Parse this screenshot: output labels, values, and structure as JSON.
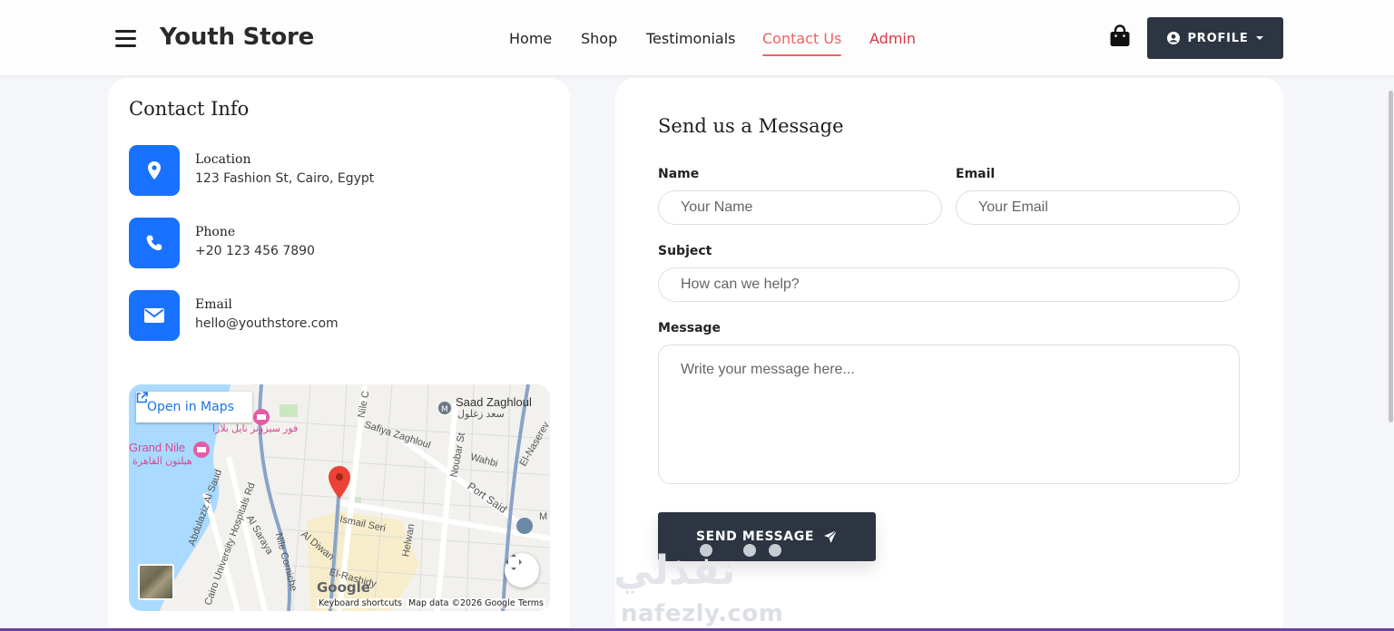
{
  "brand": {
    "name": "Youth Store"
  },
  "nav": {
    "items": [
      {
        "label": "Home"
      },
      {
        "label": "Shop"
      },
      {
        "label": "Testimonials"
      },
      {
        "label": "Contact Us",
        "active": true
      },
      {
        "label": "Admin"
      }
    ],
    "profile_label": "PROFILE",
    "cart_icon": "shopping-bag-icon",
    "profile_icon": "user-circle-icon"
  },
  "contact_info": {
    "title": "Contact Info",
    "items": [
      {
        "label": "Location",
        "value": "123 Fashion St, Cairo, Egypt",
        "icon": "map-pin-icon"
      },
      {
        "label": "Phone",
        "value": "+20 123 456 7890",
        "icon": "phone-icon"
      },
      {
        "label": "Email",
        "value": "hello@youthstore.com",
        "icon": "envelope-icon"
      }
    ]
  },
  "map": {
    "open_label": "Open in Maps",
    "labels": {
      "saad_zaghloul": "Saad Zaghloul",
      "saad_zaghloul_ar": "سعد زغلول",
      "grand_nile": "Grand Nile",
      "grand_nile_ar": "هيلتون القاهرة",
      "hotel_ar": "فور سيزونز نايل بلازا",
      "safiya_zaghloul": "Safiya Zaghloul",
      "noubar_st": "Noubar St",
      "wahbi": "Wahbi",
      "el_naserev": "El-Naserev",
      "port_said": "Port Said",
      "abdulaziz_al_saud": "Abdulaziz Al Saud",
      "cairo_university_hospitals": "Cairo University Hospitals Rd",
      "al_saraya": "Al Saraya",
      "nile_corniche": "Nile Corniche",
      "nile_c": "Nile C",
      "al_diwan": "Al Diwan",
      "ismail_seri": "Ismail Seri",
      "helwan": "Helwan",
      "el_rashidy": "El-Rashidy",
      "m": "M"
    },
    "google": "Google",
    "attribution": {
      "shortcuts": "Keyboard shortcuts",
      "data": "Map data ©2026 Google",
      "terms": "Terms"
    }
  },
  "form": {
    "title": "Send us a Message",
    "name_label": "Name",
    "name_placeholder": "Your Name",
    "email_label": "Email",
    "email_placeholder": "Your Email",
    "subject_label": "Subject",
    "subject_placeholder": "How can we help?",
    "message_label": "Message",
    "message_placeholder": "Write your message here...",
    "submit_label": "SEND MESSAGE",
    "submit_icon": "paper-plane-icon"
  },
  "watermark": {
    "arabic": "نفذلي",
    "latin": "nafezly.com"
  },
  "colors": {
    "accent_blue": "#1971ff",
    "dark_button": "#2d3442",
    "active_nav": "#f06262",
    "admin_nav": "#dc3545"
  }
}
